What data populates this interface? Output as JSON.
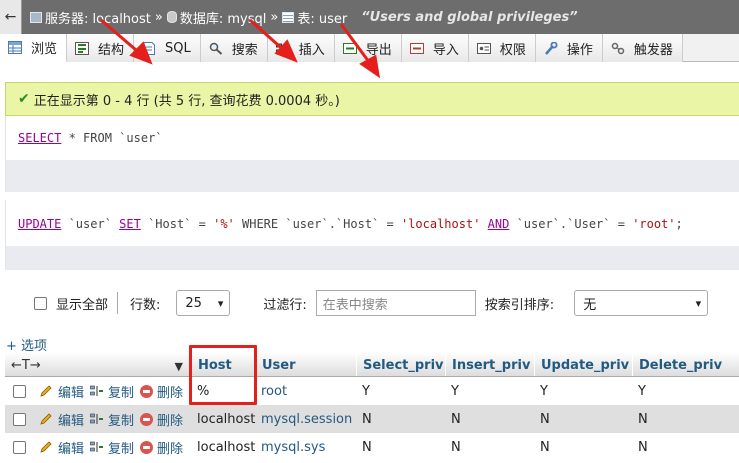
{
  "breadcrumb": {
    "back_glyph": "←",
    "server_label": "服务器: localhost",
    "database_label": "数据库: mysql",
    "table_label": "表: user",
    "separator": "»",
    "table_comment": "“Users and global privileges”"
  },
  "tabs": [
    {
      "label": "浏览",
      "icon": "browse-icon",
      "active": true
    },
    {
      "label": "结构",
      "icon": "structure-icon"
    },
    {
      "label": "SQL",
      "icon": "sql-icon"
    },
    {
      "label": "搜索",
      "icon": "search-icon"
    },
    {
      "label": "插入",
      "icon": "insert-icon"
    },
    {
      "label": "导出",
      "icon": "export-icon"
    },
    {
      "label": "导入",
      "icon": "import-icon"
    },
    {
      "label": "权限",
      "icon": "privileges-icon"
    },
    {
      "label": "操作",
      "icon": "operations-icon"
    },
    {
      "label": "触发器",
      "icon": "triggers-icon"
    }
  ],
  "success_message": "正在显示第 0 - 4 行 (共 5 行, 查询花费 0.0004 秒。)",
  "query1": {
    "kw_select": "SELECT",
    "star": " * ",
    "kw_from": "FROM",
    "table": " `user`"
  },
  "query2": {
    "kw_update": "UPDATE",
    "t1": " `user` ",
    "kw_set": "SET",
    "t2": " `Host` = ",
    "s1": "'%'",
    "kw_where": " WHERE ",
    "t3": "`user`.`Host` = ",
    "s2": "'localhost'",
    "kw_and": "AND",
    "t4": " `user`.`User` = ",
    "s3": "'root'",
    "end": ";"
  },
  "controls": {
    "show_all_label": "显示全部",
    "rows_label": "行数:",
    "rows_value": "25",
    "filter_label": "过滤行:",
    "filter_placeholder": "在表中搜索",
    "sort_label": "按索引排序:",
    "sort_value": "无"
  },
  "options_link": "+ 选项",
  "table": {
    "nav_arrows": "←T→",
    "sort_caret": "▼",
    "columns": [
      "Host",
      "User",
      "Select_priv",
      "Insert_priv",
      "Update_priv",
      "Delete_priv"
    ],
    "action_labels": {
      "edit": "编辑",
      "copy": "复制",
      "delete": "删除"
    },
    "rows": [
      [
        "%",
        "root",
        "Y",
        "Y",
        "Y",
        "Y"
      ],
      [
        "localhost",
        "mysql.session",
        "N",
        "N",
        "N",
        "N"
      ],
      [
        "localhost",
        "mysql.sys",
        "N",
        "N",
        "N",
        "N"
      ]
    ]
  },
  "colors": {
    "annotation_red": "#e3201b",
    "success_bg": "#ebf5a6",
    "link_blue": "#235a81",
    "sql_keyword": "#990099",
    "sql_string": "#aa1111"
  }
}
